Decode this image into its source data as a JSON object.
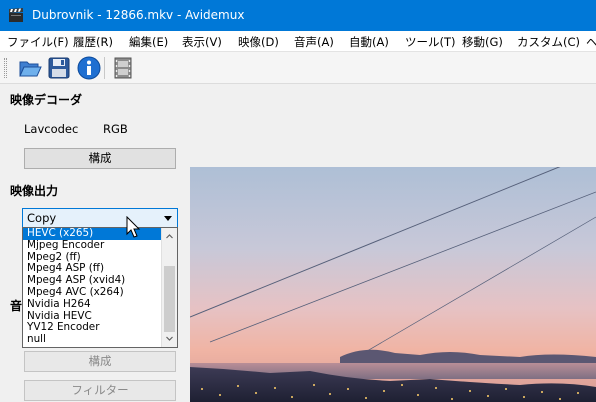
{
  "window": {
    "title": "Dubrovnik - 12866.mkv - Avidemux",
    "icon": "clapperboard-icon"
  },
  "menubar": {
    "items": [
      {
        "label": "ファイル(F)"
      },
      {
        "label": "履歴(R)"
      },
      {
        "label": "編集(E)"
      },
      {
        "label": "表示(V)"
      },
      {
        "label": "映像(D)"
      },
      {
        "label": "音声(A)"
      },
      {
        "label": "自動(A)"
      },
      {
        "label": "ツール(T)"
      },
      {
        "label": "移動(G)"
      },
      {
        "label": "カスタム(C)"
      },
      {
        "label": "ヘ"
      }
    ]
  },
  "toolbar": {
    "icons": [
      "open-folder-icon",
      "save-disk-icon",
      "info-icon",
      "film-strip-icon"
    ]
  },
  "video_decoder": {
    "title": "映像デコーダ",
    "decoder": "Lavcodec",
    "format": "RGB",
    "configure_label": "構成"
  },
  "video_output": {
    "title": "映像出力",
    "selected": "Copy",
    "options": [
      {
        "label": "HEVC (x265)",
        "selected": true
      },
      {
        "label": "Mjpeg Encoder",
        "selected": false
      },
      {
        "label": "Mpeg2 (ff)",
        "selected": false
      },
      {
        "label": "Mpeg4 ASP (ff)",
        "selected": false
      },
      {
        "label": "Mpeg4 ASP (xvid4)",
        "selected": false
      },
      {
        "label": "Mpeg4 AVC (x264)",
        "selected": false
      },
      {
        "label": "Nvidia H264",
        "selected": false
      },
      {
        "label": "Nvidia HEVC",
        "selected": false
      },
      {
        "label": "YV12 Encoder",
        "selected": false
      },
      {
        "label": "null",
        "selected": false
      }
    ],
    "configure_label": "構成",
    "filter_label": "フィルター"
  },
  "audio_section": {
    "title_fragment": "音"
  },
  "colors": {
    "titlebar": "#0078d7",
    "selection": "#0078d7"
  }
}
